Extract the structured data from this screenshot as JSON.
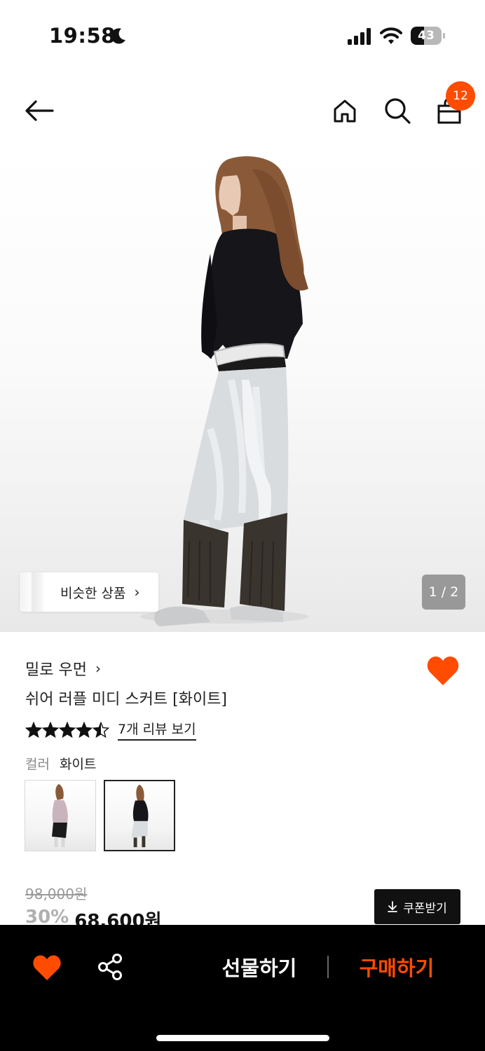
{
  "status_bar": {
    "time": "19:58",
    "battery": "43",
    "battery_level_percent": 43
  },
  "nav": {
    "back_icon": "arrow-left-icon",
    "home_icon": "home-icon",
    "search_icon": "search-icon",
    "cart_icon": "shopping-bag-icon",
    "cart_count": "12"
  },
  "hero": {
    "similar_label": "비슷한 상품",
    "page_indicator": "1 / 2"
  },
  "product": {
    "brand": "밀로 우먼",
    "name": "쉬어 러플 미디 스커트 [화이트]",
    "rating": 4.5,
    "review_link": "7개 리뷰 보기",
    "color_key": "컬러",
    "color_value": "화이트",
    "original_price": "98,000원",
    "discount": "30%",
    "sale_price": "68,600원",
    "coupon_label": "쿠폰받기"
  },
  "bottom_bar": {
    "gift_label": "선물하기",
    "buy_label": "구매하기"
  },
  "colors": {
    "accent": "#ff4c00",
    "bar_bg": "#000000"
  }
}
